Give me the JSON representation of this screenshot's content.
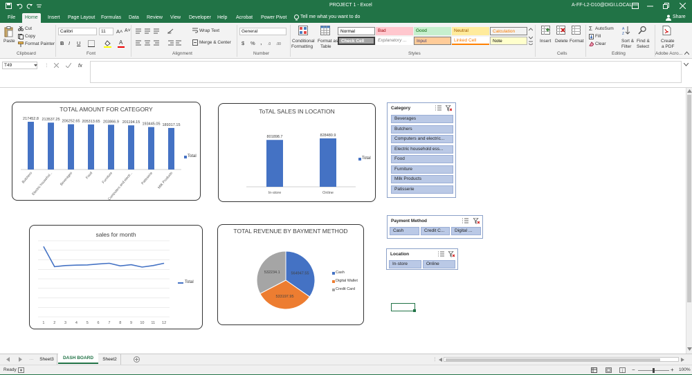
{
  "title_bar": {
    "doc_title": "PROJECT 1  -  Excel",
    "account": "A-FF-L2-D10@DIGI.LOCAL"
  },
  "tabs": [
    {
      "label": "File",
      "active": false
    },
    {
      "label": "Home",
      "active": true
    },
    {
      "label": "Insert",
      "active": false
    },
    {
      "label": "Page Layout",
      "active": false
    },
    {
      "label": "Formulas",
      "active": false
    },
    {
      "label": "Data",
      "active": false
    },
    {
      "label": "Review",
      "active": false
    },
    {
      "label": "View",
      "active": false
    },
    {
      "label": "Developer",
      "active": false
    },
    {
      "label": "Help",
      "active": false
    },
    {
      "label": "Acrobat",
      "active": false
    },
    {
      "label": "Power Pivot",
      "active": false
    }
  ],
  "tell_me": "Tell me what you want to do",
  "share_label": "Share",
  "ribbon": {
    "clipboard": {
      "paste": "Paste",
      "cut": "Cut",
      "copy": "Copy",
      "format_painter": "Format Painter",
      "group": "Clipboard"
    },
    "font": {
      "name": "Calibri",
      "size": "11",
      "bold": "B",
      "italic": "I",
      "underline": "U",
      "font_color_glyph": "A",
      "group": "Font"
    },
    "alignment": {
      "wrap_text": "Wrap Text",
      "merge_center": "Merge & Center",
      "group": "Alignment"
    },
    "number": {
      "format": "General",
      "currency": "$",
      "percent": "%",
      "comma": ",",
      "group": "Number"
    },
    "styles": {
      "conditional": [
        "Conditional",
        "Formatting"
      ],
      "format_table": [
        "Format as",
        "Table"
      ],
      "cells": {
        "normal": "Normal",
        "bad": "Bad",
        "good": "Good",
        "neutral": "Neutral",
        "calculation": "Calculation",
        "check": "Check Cell",
        "explanatory": "Explanatory ...",
        "input": "Input",
        "linked": "Linked Cell",
        "note": "Note"
      },
      "group": "Styles"
    },
    "cells_group": {
      "insert": "Insert",
      "delete": "Delete",
      "format": "Format",
      "group": "Cells"
    },
    "editing": {
      "autosum": "AutoSum",
      "fill": "Fill",
      "clear": "Clear",
      "sort": [
        "Sort &",
        "Filter"
      ],
      "find": [
        "Find &",
        "Select"
      ],
      "group": "Editing"
    },
    "adobe": {
      "create": [
        "Create",
        "a PDF"
      ],
      "group": "Adobe Acro..."
    }
  },
  "formula_bar": {
    "name_box": "T49",
    "fx": "fx",
    "formula": ""
  },
  "colors": {
    "brand_green": "#217346",
    "bar_blue": "#4472c4",
    "pie_orange": "#ed7d31",
    "pie_gray": "#a5a5a5",
    "slicer_item": "#bac9e6"
  },
  "charts": {
    "category": {
      "title": "TOTAL AMOUNT FOR CATEGORY",
      "legend": "Total",
      "chart_data": {
        "type": "bar",
        "title": "TOTAL AMOUNT FOR CATEGORY",
        "categories": [
          "Butchers",
          "Electric househol...",
          "Beverages",
          "Food",
          "Furniture",
          "Computers and electr...",
          "Patisserie",
          "Milk Products"
        ],
        "series": [
          {
            "name": "Total",
            "values": [
              217452.8,
              213537.25,
              206252.65,
              205313.65,
              203866.9,
              201194.15,
              193445.05,
              189317.15
            ]
          }
        ],
        "value_labels": [
          "217452.8",
          "213537.25",
          "206252.65",
          "205313.65",
          "203866.9",
          "201194.15",
          "193445.05",
          "189317.15"
        ],
        "legend": "right"
      }
    },
    "location": {
      "title": "ToTAL SALES IN LOCATION",
      "legend": "Total",
      "chart_data": {
        "type": "bar",
        "title": "ToTAL SALES IN LOCATION",
        "categories": [
          "In-store",
          "Online"
        ],
        "series": [
          {
            "name": "Total",
            "values": [
              801898.7,
              828480.9
            ]
          }
        ],
        "value_labels": [
          "801898.7",
          "828480.9"
        ],
        "legend": "right"
      }
    },
    "month": {
      "title": "sales for month",
      "legend": "Total",
      "chart_data": {
        "type": "line",
        "title": "sales for month",
        "x": [
          "1",
          "2",
          "3",
          "4",
          "5",
          "6",
          "7",
          "8",
          "9",
          "10",
          "11",
          "12"
        ],
        "series": [
          {
            "name": "Total",
            "values": [
              185000,
              132000,
              135000,
              136000,
              136500,
              139000,
              141000,
              134000,
              137000,
              131000,
              135000,
              141000
            ]
          }
        ],
        "ylim": [
          0,
          200000
        ],
        "grid": true,
        "legend": "right"
      }
    },
    "payment": {
      "title": "TOTAL REVENUE BY BAYMENT METHOD",
      "chart_data": {
        "type": "pie",
        "title": "TOTAL REVENUE BY BAYMENT METHOD",
        "labels": [
          "Cash",
          "Digital Wallet",
          "Credit Card"
        ],
        "values": [
          564947.55,
          533197.95,
          532234.1
        ],
        "value_labels": [
          "564947.55",
          "533197.95",
          "532234.1"
        ],
        "legend": "right"
      }
    }
  },
  "slicers": {
    "category": {
      "title": "Category",
      "items": [
        "Beverages",
        "Butchers",
        "Computers and electric...",
        "Electric household ess...",
        "Food",
        "Furniture",
        "Milk Products",
        "Patisserie"
      ]
    },
    "payment": {
      "title": "Payment Method",
      "items": [
        "Cash",
        "Credit C...",
        "Digital ..."
      ]
    },
    "location": {
      "title": "Location",
      "items": [
        "In-store",
        "Online"
      ]
    }
  },
  "sheet_tabs": [
    {
      "label": "Sheet3",
      "active": false
    },
    {
      "label": "DASH BOARD",
      "active": true
    },
    {
      "label": "Sheet2",
      "active": false
    }
  ],
  "status": {
    "ready": "Ready",
    "zoom": "100%"
  }
}
